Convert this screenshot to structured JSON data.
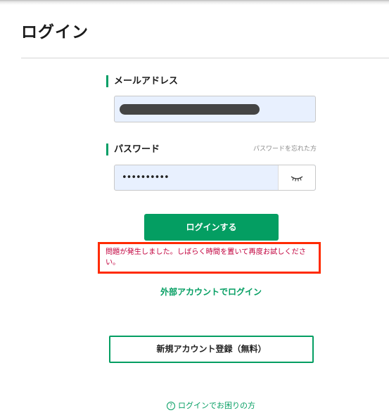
{
  "page": {
    "title": "ログイン"
  },
  "form": {
    "email_label": "メールアドレス",
    "email_value": "",
    "password_label": "パスワード",
    "forgot_password": "パスワードを忘れた方",
    "password_value": "••••••••••",
    "show_password_icon": "eye-closed-icon",
    "submit_label": "ログインする"
  },
  "error": {
    "message": "問題が発生しました。しばらく時間を置いて再度お試しください。",
    "border_color": "#ff2a00",
    "text_color": "#c2003d"
  },
  "links": {
    "external_login": "外部アカウントでログイン",
    "register": "新規アカウント登録（無料）",
    "help": "ログインでお困りの方",
    "help_icon": "question-circle-icon"
  },
  "colors": {
    "accent": "#049e62"
  }
}
